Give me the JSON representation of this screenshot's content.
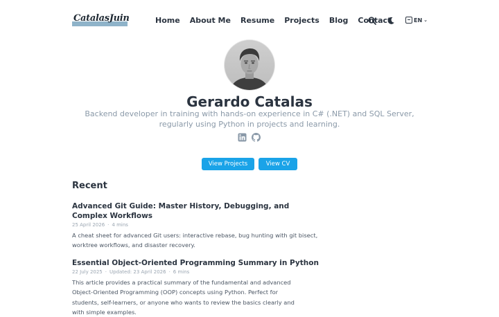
{
  "header": {
    "logo_text": "CatalasJuin",
    "nav": [
      "Home",
      "About Me",
      "Resume",
      "Projects",
      "Blog",
      "Contact"
    ],
    "language": "EN",
    "icons": [
      "search-icon",
      "moon-icon",
      "translate-icon",
      "chevron-down-icon"
    ]
  },
  "profile": {
    "name": "Gerardo Catalas",
    "bio": "Backend developer in training with hands-on experience in C# (.NET) and SQL Server, regularly using Python in projects and learning.",
    "socials": [
      "linkedin-icon",
      "github-icon"
    ],
    "buttons": {
      "projects": " View Projects",
      "cv": " View CV"
    }
  },
  "recent": {
    "heading": "Recent",
    "posts": [
      {
        "title": "Advanced Git Guide: Master History, Debugging, and Complex Workflows",
        "date": "25 April 2026",
        "read_time": "4 mins",
        "excerpt": "A cheat sheet for advanced Git users: interactive rebase, bug hunting with git bisect, worktree workflows, and disaster recovery."
      },
      {
        "title": "Essential Object-Oriented Programming Summary in Python",
        "date": "22 July 2025",
        "updated": "Updated: 23 April 2026",
        "read_time": "6 mins",
        "excerpt": "This article provides a practical summary of the fundamental and advanced Object-Oriented Programming (OOP) concepts using Python. Perfect for students, self-learners, or anyone who wants to review the basics clearly and with simple examples."
      }
    ]
  },
  "colors": {
    "accent": "#1aa3e8",
    "text": "#2b3440",
    "muted": "#8a99a8"
  }
}
